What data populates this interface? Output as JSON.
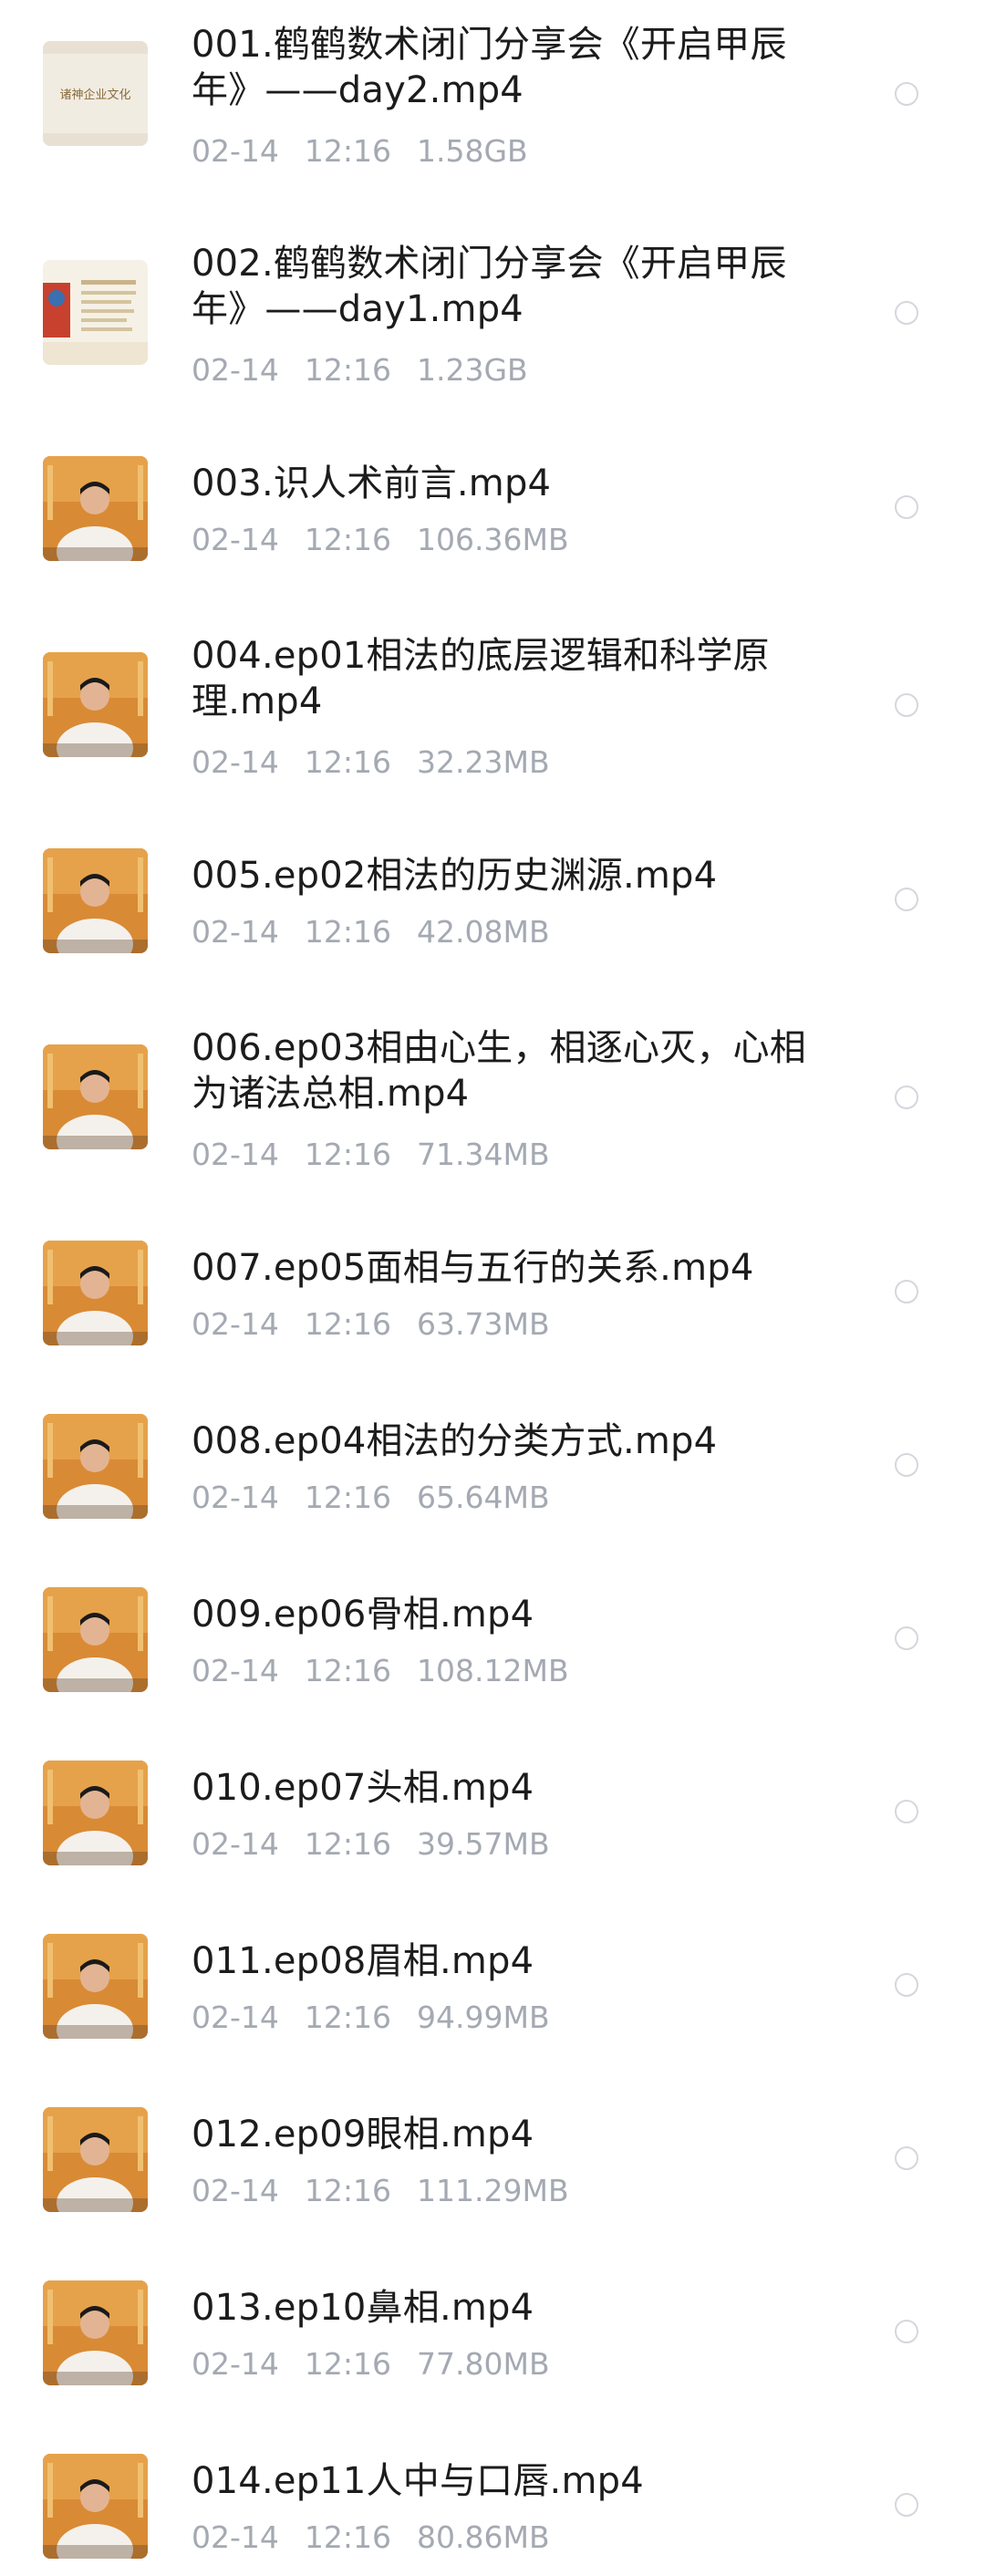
{
  "files": [
    {
      "name": "001.鹤鹤数术闭门分享会《开启甲辰年》——day2.mp4",
      "date": "02-14",
      "time": "12:16",
      "size": "1.58GB",
      "thumbnail": "calligraphy-banner"
    },
    {
      "name": "002.鹤鹤数术闭门分享会《开启甲辰年》——day1.mp4",
      "date": "02-14",
      "time": "12:16",
      "size": "1.23GB",
      "thumbnail": "slide-presentation"
    },
    {
      "name": "003.识人术前言.mp4",
      "date": "02-14",
      "time": "12:16",
      "size": "106.36MB",
      "thumbnail": "presenter-video"
    },
    {
      "name": "004.ep01相法的底层逻辑和科学原理.mp4",
      "date": "02-14",
      "time": "12:16",
      "size": "32.23MB",
      "thumbnail": "presenter-video"
    },
    {
      "name": "005.ep02相法的历史渊源.mp4",
      "date": "02-14",
      "time": "12:16",
      "size": "42.08MB",
      "thumbnail": "presenter-video"
    },
    {
      "name": "006.ep03相由心生，相逐心灭，心相为诸法总相.mp4",
      "date": "02-14",
      "time": "12:16",
      "size": "71.34MB",
      "thumbnail": "presenter-video"
    },
    {
      "name": "007.ep05面相与五行的关系.mp4",
      "date": "02-14",
      "time": "12:16",
      "size": "63.73MB",
      "thumbnail": "presenter-video"
    },
    {
      "name": "008.ep04相法的分类方式.mp4",
      "date": "02-14",
      "time": "12:16",
      "size": "65.64MB",
      "thumbnail": "presenter-video"
    },
    {
      "name": "009.ep06骨相.mp4",
      "date": "02-14",
      "time": "12:16",
      "size": "108.12MB",
      "thumbnail": "presenter-video"
    },
    {
      "name": "010.ep07头相.mp4",
      "date": "02-14",
      "time": "12:16",
      "size": "39.57MB",
      "thumbnail": "presenter-video"
    },
    {
      "name": "011.ep08眉相.mp4",
      "date": "02-14",
      "time": "12:16",
      "size": "94.99MB",
      "thumbnail": "presenter-video"
    },
    {
      "name": "012.ep09眼相.mp4",
      "date": "02-14",
      "time": "12:16",
      "size": "111.29MB",
      "thumbnail": "presenter-video"
    },
    {
      "name": "013.ep10鼻相.mp4",
      "date": "02-14",
      "time": "12:16",
      "size": "77.80MB",
      "thumbnail": "presenter-video"
    },
    {
      "name": "014.ep11人中与口唇.mp4",
      "date": "02-14",
      "time": "12:16",
      "size": "80.86MB",
      "thumbnail": "presenter-video"
    }
  ],
  "thumbnail_texts": {
    "calligraphy-banner": "诸神企业文化"
  },
  "colors": {
    "name_text": "#1c1c1c",
    "meta_text": "#a4a9b2",
    "radio_border": "#d4d7dc",
    "background": "#ffffff"
  },
  "icons": {
    "select": "radio-circle-icon"
  }
}
